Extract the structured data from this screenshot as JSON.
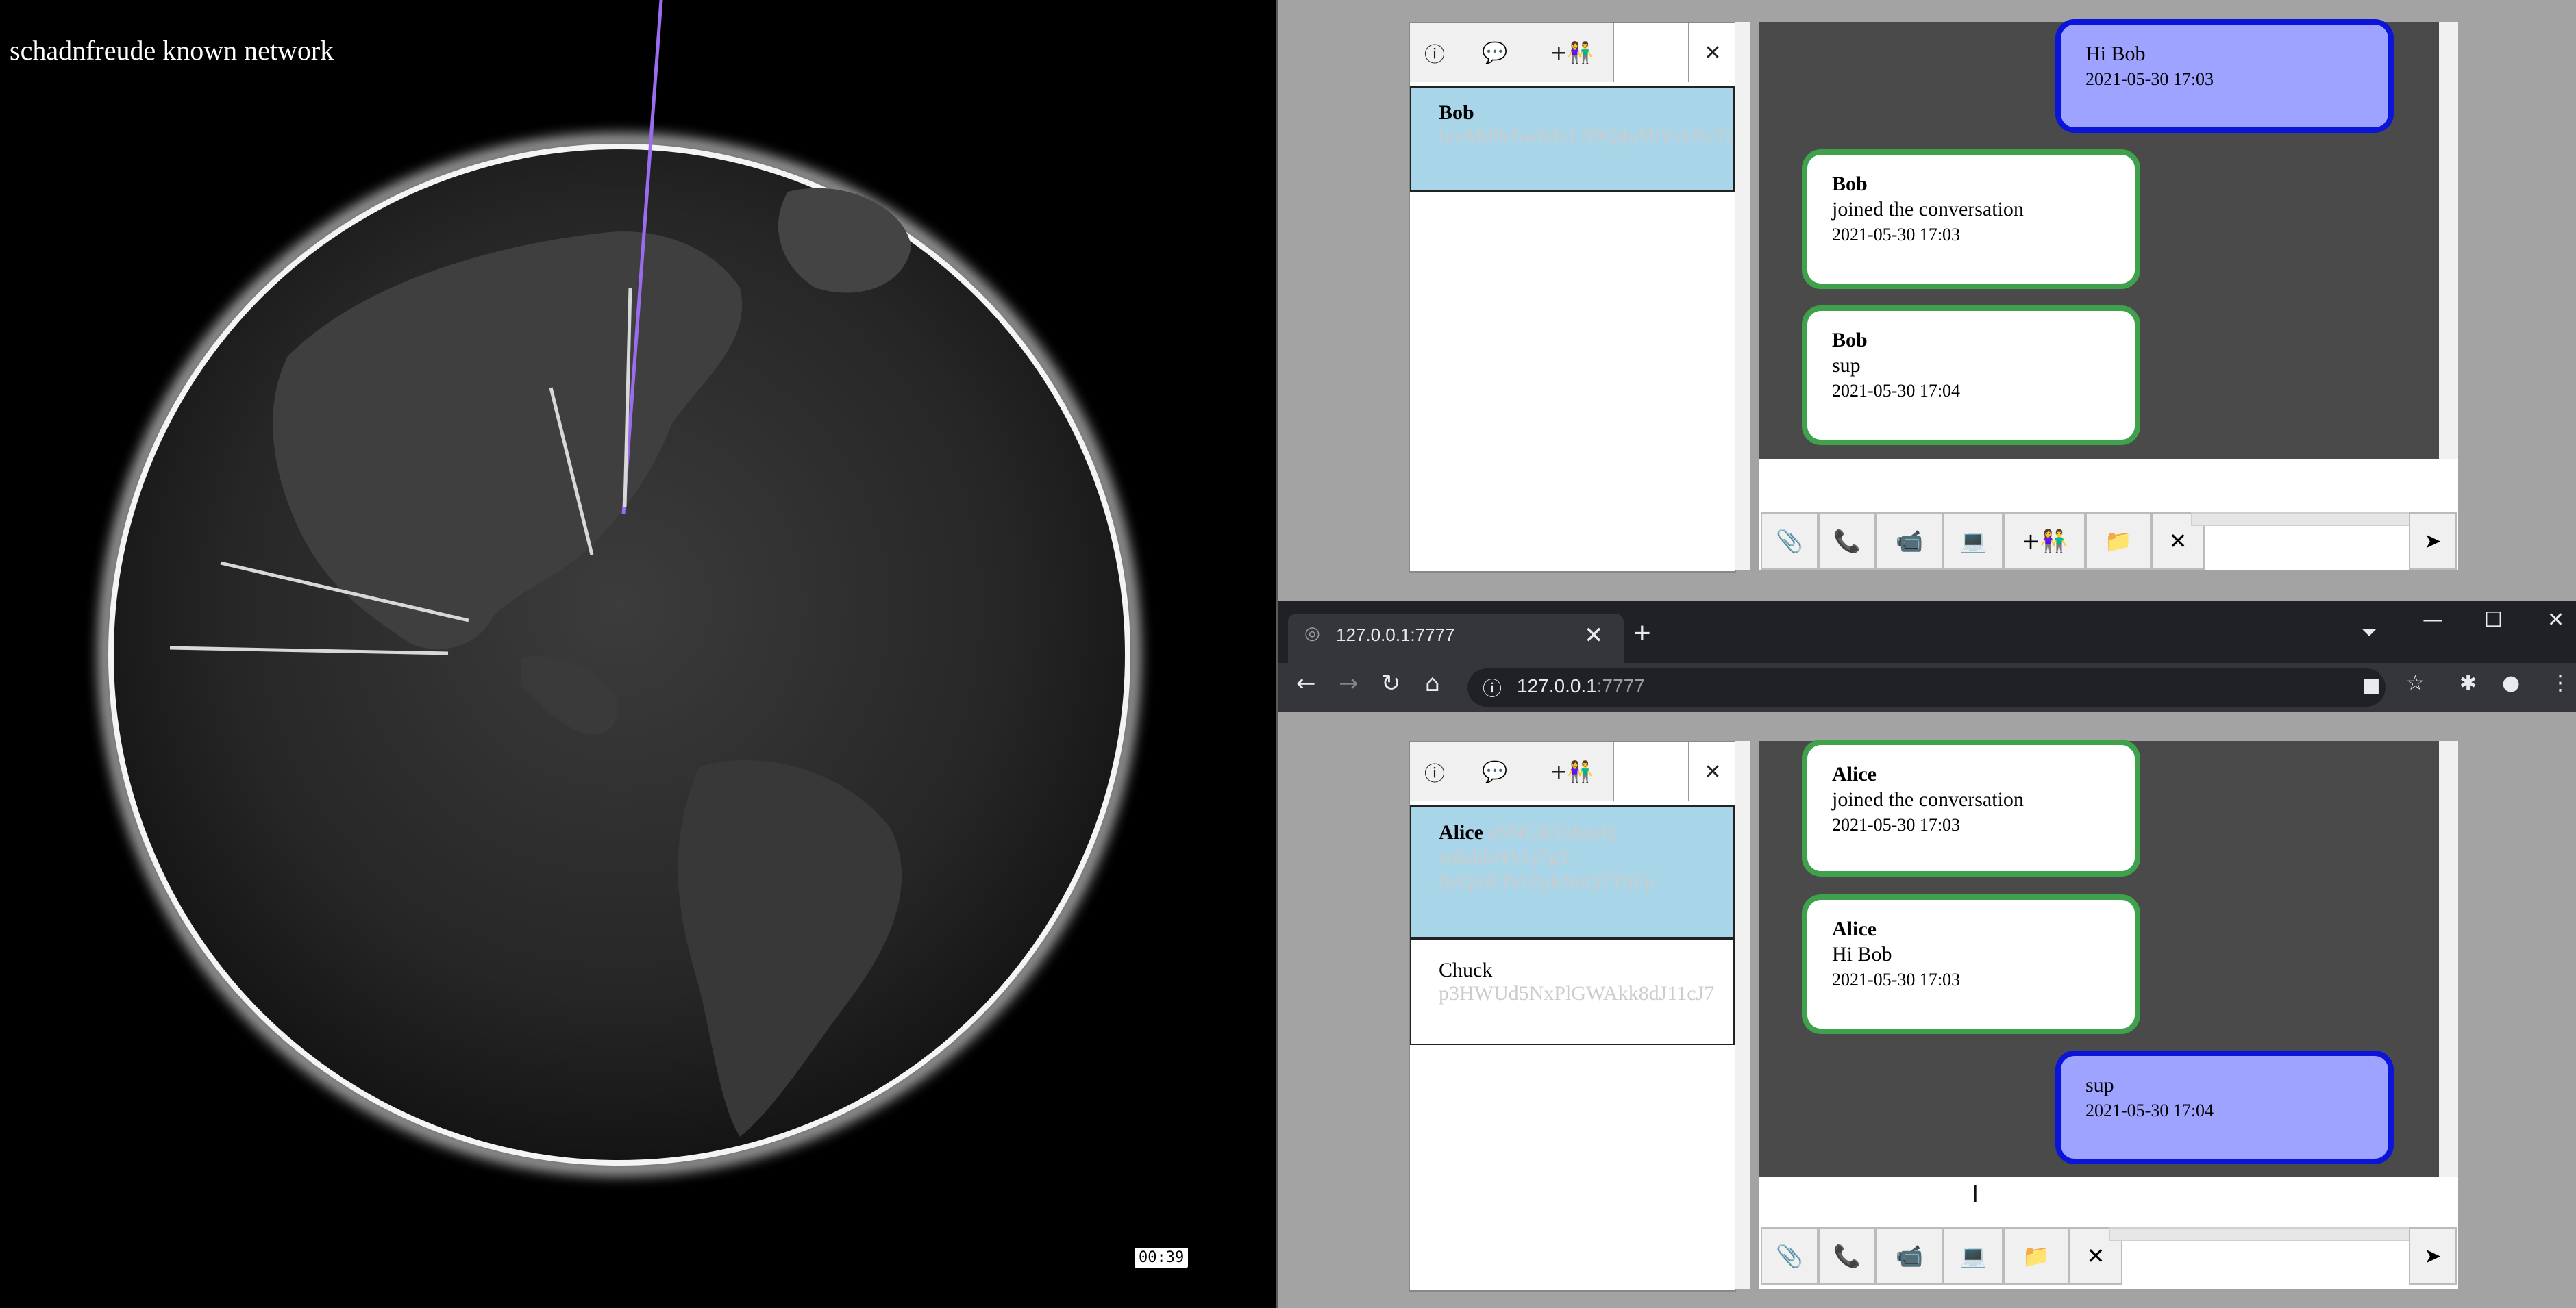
{
  "globe": {
    "title": "schadnfreude known network",
    "timer": "00:39"
  },
  "browser": {
    "tab_title": "127.0.0.1:7777",
    "url_host": "127.0.0.1",
    "url_port": ":7777"
  },
  "icons": {
    "info": "ⓘ",
    "chat": "💬",
    "add_people": "+👫",
    "close": "✕",
    "attach": "📎",
    "phone": "📞",
    "video": "📹",
    "laptop": "💻",
    "folder": "📁",
    "send": "➤"
  },
  "top_app": {
    "contacts": [
      {
        "name": "Bob",
        "id": "bmMd8cbw64xLS9Q4u5bYvkRsTdWXgcPVn7LD8F"
      }
    ],
    "messages": [
      {
        "mine": true,
        "text": "Hi Bob",
        "time": "2021-05-30 17:03"
      },
      {
        "mine": false,
        "sender": "Bob",
        "text": "joined the conversation",
        "time": "2021-05-30 17:03"
      },
      {
        "mine": false,
        "sender": "Bob",
        "text": "sup",
        "time": "2021-05-30 17:04"
      }
    ]
  },
  "bottom_app": {
    "contacts": [
      {
        "name": "Alice",
        "id_lines": [
          "aSNGR1hbxsQ",
          "w8zbbNVQ7gT",
          "8yQxR3Vr2pK9nQ7TbFp"
        ]
      },
      {
        "name": "Chuck",
        "id": "p3HWUd5NxPlGWAkk8dJ11cJ7"
      }
    ],
    "messages": [
      {
        "mine": false,
        "sender": "Alice",
        "text": "joined the conversation",
        "time": "2021-05-30 17:03"
      },
      {
        "mine": false,
        "sender": "Alice",
        "text": "Hi Bob",
        "time": "2021-05-30 17:03"
      },
      {
        "mine": true,
        "text": "sup",
        "time": "2021-05-30 17:04"
      }
    ]
  }
}
